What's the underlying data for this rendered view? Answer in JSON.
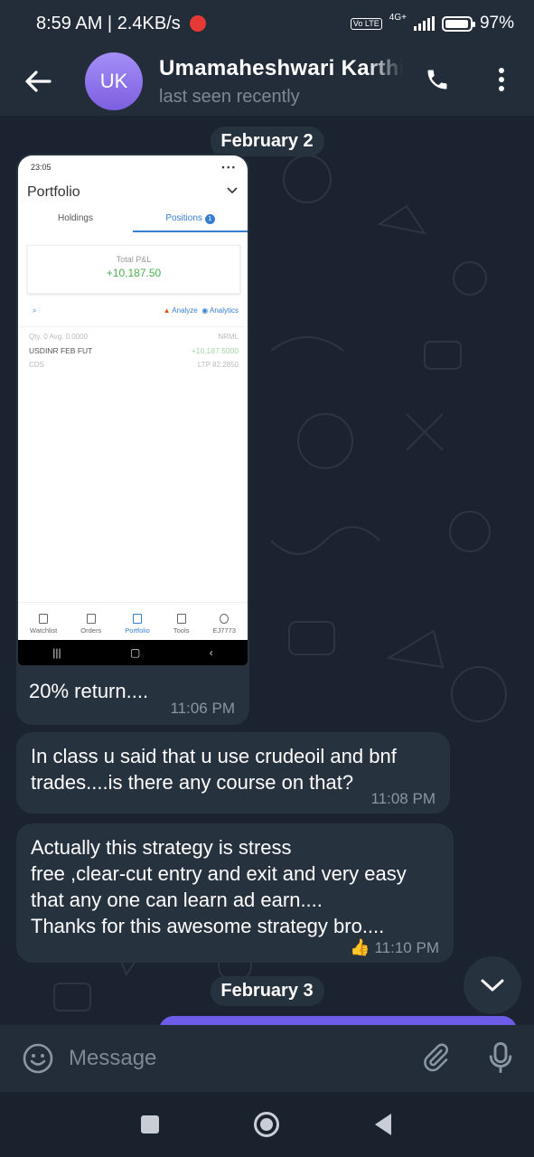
{
  "status_bar": {
    "time_speed": "8:59 AM | 2.4KB/s",
    "network": "4G+",
    "volte": "Vo LTE",
    "battery": "97%",
    "battery_level": 0.97
  },
  "header": {
    "avatar_initials": "UK",
    "avatar_color": "#8e74ec",
    "name": "Umamaheshwari Karthikeyan",
    "status": "last seen recently"
  },
  "messages": {
    "date_1": "February 2",
    "image_msg": {
      "screenshot": {
        "status_time": "23:05",
        "title": "Portfolio",
        "tab_holdings": "Holdings",
        "tab_positions": "Positions",
        "positions_badge": "1",
        "pnl_label": "Total P&L",
        "pnl_value": "+10,187.50",
        "analyze": "Analyze",
        "analytics": "Analytics",
        "row_qty": "Qty. 0  Avg. 0.0000",
        "row_type": "NRML",
        "row_symbol": "USDINR FEB FUT",
        "row_pnl": "+10,187.5000",
        "row_exchange": "CDS",
        "row_ltp": "LTP 82.2850",
        "nav": [
          "Watchlist",
          "Orders",
          "Portfolio",
          "Tools",
          "EJ7773"
        ]
      },
      "caption": "20% return....",
      "time": "11:06 PM"
    },
    "msg_2": {
      "text": "In class u said that u use crudeoil and bnf trades....is there any course on that?",
      "time": "11:08 PM"
    },
    "msg_3": {
      "text_lines": [
        "Actually this strategy is stress",
        "free ,clear-cut entry and exit and very easy",
        "that any one can learn ad earn....",
        "Thanks for this awesome strategy bro...."
      ],
      "reaction": "👍",
      "time": "11:10 PM"
    },
    "date_2": "February 3"
  },
  "input": {
    "placeholder": "Message"
  },
  "colors": {
    "bg": "#1b2330",
    "bar": "#232d3a",
    "bubble": "#27323f",
    "accent": "#6c5ce7",
    "pnl_green": "#4caf50",
    "kite_blue": "#387ed1"
  },
  "icons": [
    "back-arrow-icon",
    "phone-icon",
    "more-vert-icon",
    "chevron-down-icon",
    "emoji-icon",
    "paperclip-icon",
    "microphone-icon",
    "square-icon",
    "circle-icon",
    "triangle-back-icon"
  ]
}
